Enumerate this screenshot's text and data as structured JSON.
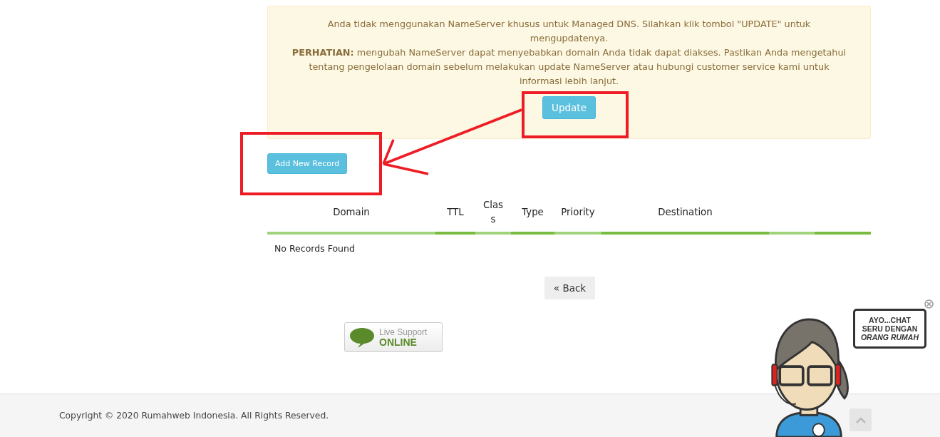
{
  "notice": {
    "message": "Anda tidak menggunakan NameServer khusus untuk Managed DNS. Silahkan klik tombol \"UPDATE\" untuk mengupdatenya.",
    "warning": "**PERHATIAN:** mengubah NameServer dapat menyebabkan domain Anda tidak dapat diakses. Pastikan Anda mengetahui tentang pengelolaan domain sebelum melakukan update NameServer atau hubungi customer service kami untuk informasi lebih lanjut.",
    "button": "Update"
  },
  "add_button": "Add New Record",
  "table": {
    "columns": [
      "Domain",
      "TTL",
      "Clas s",
      "Type",
      "Priority",
      "Destination"
    ],
    "empty_message": "No Records Found"
  },
  "back_button": "« Back",
  "live_support": {
    "line1": "Live Support",
    "line2": "ONLINE"
  },
  "chat_bubble": {
    "line1": "AYO...CHAT",
    "line2": "SERU DENGAN",
    "line3": "ORANG RUMAH"
  },
  "footer": {
    "copyright": "Copyright © 2020 Rumahweb Indonesia. All Rights Reserved."
  }
}
